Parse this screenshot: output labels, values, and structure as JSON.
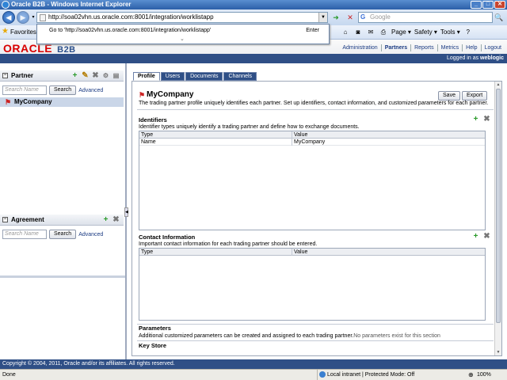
{
  "browser": {
    "window_title": "Oracle B2B - Windows Internet Explorer",
    "url": "http://soa02vhn.us.oracle.com:8001/integration/worklistapp",
    "search_placeholder": "Google",
    "favorites_label": "Favorites",
    "autocomplete": {
      "goto_text": "Go to 'http://soa02vhn.us.oracle.com:8001/integration/worklistapp'",
      "enter_label": "Enter"
    },
    "toolbar": {
      "page_label": "Page ▾",
      "safety_label": "Safety ▾",
      "tools_label": "Tools ▾",
      "help_glyph": "?"
    }
  },
  "header": {
    "logo_oracle": "ORACLE",
    "logo_product": "B2B",
    "nav": [
      "Administration",
      "Partners",
      "Reports",
      "Metrics",
      "Help",
      "Logout"
    ],
    "active_nav": "Partners",
    "logged_in_prefix": "Logged in as ",
    "logged_in_user": "weblogic"
  },
  "partner_panel": {
    "title": "Partner",
    "search_placeholder": "Search Name",
    "search_button": "Search",
    "advanced_link": "Advanced",
    "items": [
      "MyCompany"
    ]
  },
  "agreement_panel": {
    "title": "Agreement",
    "search_placeholder": "Search Name",
    "search_button": "Search",
    "advanced_link": "Advanced"
  },
  "tabs": [
    "Profile",
    "Users",
    "Documents",
    "Channels"
  ],
  "active_tab": "Profile",
  "profile": {
    "title": "MyCompany",
    "save_button": "Save",
    "export_button": "Export",
    "description": "The trading partner profile uniquely identifies each partner. Set up identifiers, contact information, and customized parameters for each partner.",
    "identifiers": {
      "title": "Identifiers",
      "description": "Identifier types uniquely identify a trading partner and define how to exchange documents.",
      "columns": [
        "Type",
        "Value"
      ],
      "rows": [
        [
          "Name",
          "MyCompany"
        ]
      ]
    },
    "contact": {
      "title": "Contact Information",
      "description": "Important contact information for each trading partner should be entered.",
      "columns": [
        "Type",
        "Value"
      ]
    },
    "parameters": {
      "title": "Parameters",
      "description": "Additional customized parameters can be created and assigned to each trading partner.",
      "empty_text": "No parameters exist for this section"
    },
    "keystore": {
      "title": "Key Store"
    }
  },
  "footer": {
    "copyright": "Copyright © 2004, 2011, Oracle and/or its affiliates. All rights reserved."
  },
  "statusbar": {
    "done": "Done",
    "zone": "Local intranet | Protected Mode: Off",
    "zoom": "100%"
  }
}
